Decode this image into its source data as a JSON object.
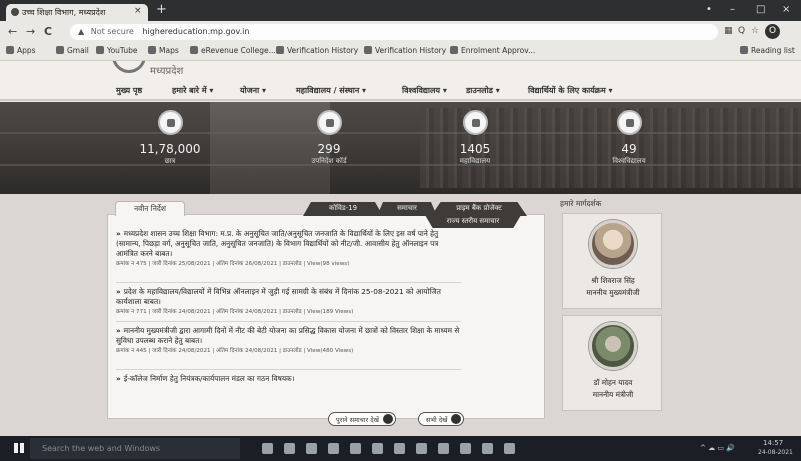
{
  "browser": {
    "tab_title": "उच्च शिक्षा विभाग, मध्यप्रदेश",
    "tab_close": "×",
    "new_tab": "+",
    "window_controls": [
      "•",
      "–",
      "□",
      "×"
    ],
    "url_warning": "▲",
    "url_not_secure": "Not secure",
    "url": "highereducation.mp.gov.in",
    "nav": [
      "←",
      "→",
      "C"
    ],
    "toolbar_icons": [
      "▦",
      "Q",
      "☆"
    ],
    "avatar": "O",
    "bookmarks": [
      "Apps",
      "Gmail",
      "YouTube",
      "Maps",
      "eRevenue College...",
      "Verification History",
      "Verification History",
      "Enrolment Approv...",
      "Reading list"
    ]
  },
  "site": {
    "logo_text": "मध्यप्रदेश",
    "menu": [
      "मुख्य पृष्ठ",
      "हमारे बारे में ▾",
      "योजना ▾",
      "महाविद्यालय / संस्थान ▾",
      "विश्वविद्यालय ▾",
      "डाउनलोड ▾",
      "विद्यार्थियों के लिए कार्यक्रम ▾"
    ],
    "stats": [
      {
        "value": "11,78,000",
        "label": "छात्र"
      },
      {
        "value": "299",
        "label": "उपनिदेश कॉर्ड"
      },
      {
        "value": "1405",
        "label": "महाविद्यालय"
      },
      {
        "value": "49",
        "label": "विश्वविद्यालय"
      }
    ],
    "tabs": {
      "active": "नवीन निर्देश",
      "others": [
        "कोविड-19",
        "समाचार",
        "प्राइम बैंक प्रोजेक्ट"
      ],
      "second_row": "राज्य स्तरीय समाचार"
    },
    "notices": [
      {
        "text": "मध्यप्रदेश शासन उच्च शिक्षा विभाग: म.प्र. के अनुसूचित जाति/अनुसूचित जनजाति के विद्यार्थियों के लिए इस वर्ष पाने हेतु (सामान्य, पिछड़ा वर्ग, अनुसूचित जाति, अनुसूचित जनजाति) के विभाग विद्यार्थियों को नीट/जी. आवासीय हेतु ऑनलाइन पत्र आमंत्रित करने बाबत।",
        "meta": "क्रमांक न 475 | जारी दिनांक 25/08/2021 | अंतिम दिनांक 26/08/2021 | डाउनलोड | View(98 views)"
      },
      {
        "text": "प्रदेश के महाविद्यालय/विद्यालयों में विभिन्न ऑनलाइन में जुड़ी गई सामग्री के संबंध में दिनांक 25-08-2021 को आयोजित कार्यशाला बाबत।",
        "meta": "क्रमांक न 771 | जारी दिनांक 24/08/2021 | अंतिम दिनांक 24/08/2021 | डाउनलोड | View(189 Views)"
      },
      {
        "text": "माननीय मुख्यमंत्रीजी द्वारा आगामी दिनों में नीट की बेटी योजना का प्रसिद्ध विकास योजना में छात्रों को विस्तार शिक्षा के माध्यम से सुविधा उपलब्ध कराने हेतु बाबत।",
        "meta": "क्रमांक न 445 | जारी दिनांक 24/08/2021 | अंतिम दिनांक 24/08/2021 | डाउनलोड | View(480 Views)"
      },
      {
        "text": "ई-कॉलेज निर्माण हेतु नियंत्रक/कार्यपालन मंडल का गठन विषयक।",
        "meta": ""
      }
    ],
    "btn_old": "पुराने समाचार देखें",
    "btn_all": "सभी देखें",
    "officials_title": "हमारे मार्गदर्शक",
    "officials": [
      {
        "name": "श्री शिवराज सिंह",
        "role": "माननीय मुख्यमंत्रीजी"
      },
      {
        "name": "डॉ मोहन यादव",
        "role": "माननीय मंत्रीजी"
      }
    ]
  },
  "taskbar": {
    "search": "Search the web and Windows",
    "tray": "^ ☁ ▭ 🔊",
    "time": "14:57",
    "date": "24-08-2021"
  }
}
